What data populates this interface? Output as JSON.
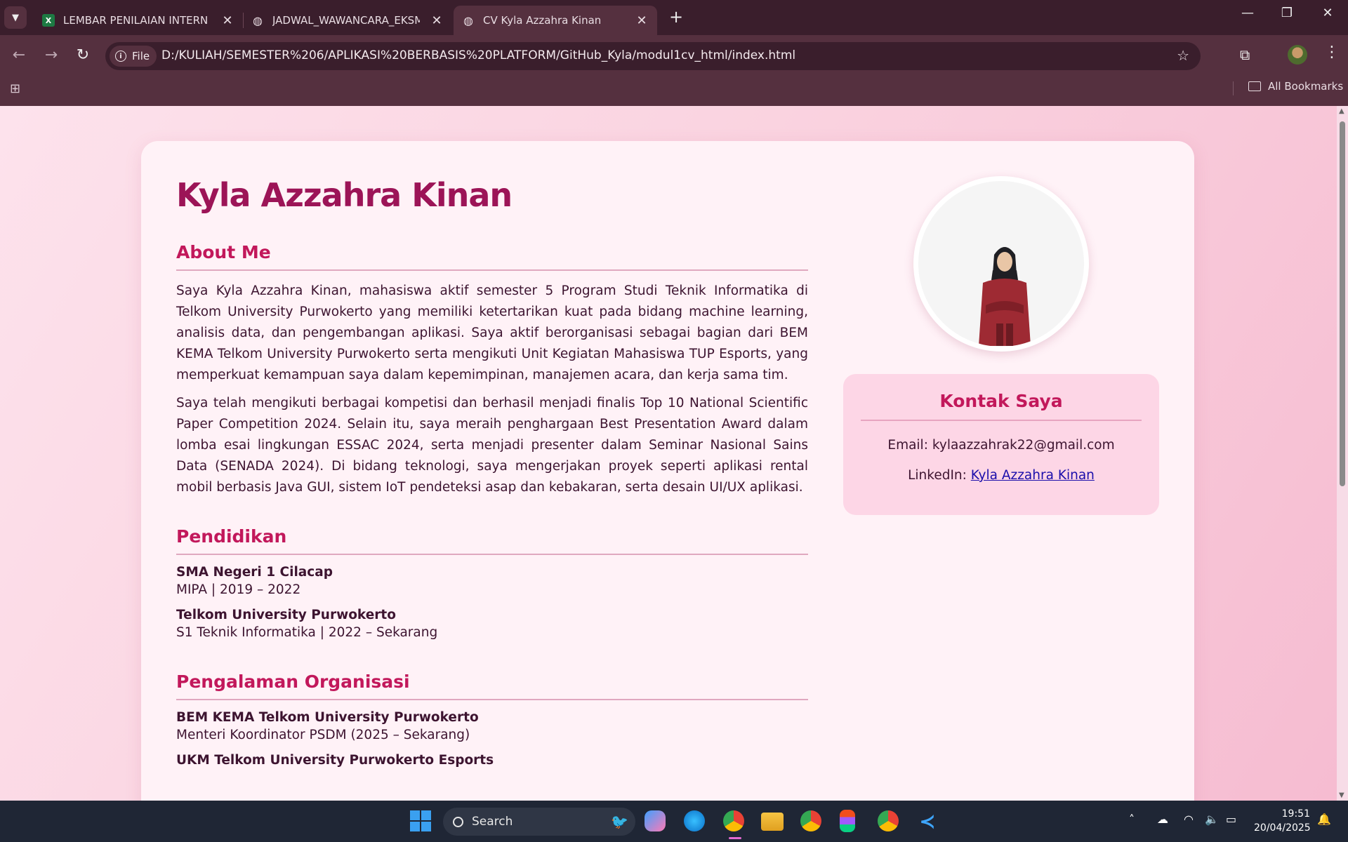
{
  "browser": {
    "tabs": [
      {
        "title": "LEMBAR PENILAIAN INTERN BE",
        "icon": "excel-icon"
      },
      {
        "title": "JADWAL_WAWANCARA_EKSMU",
        "icon": "globe-icon"
      },
      {
        "title": "CV Kyla Azzahra Kinan",
        "icon": "globe-icon",
        "active": true
      }
    ],
    "file_chip": "File",
    "url": "D:/KULIAH/SEMESTER%206/APLIKASI%20BERBASIS%20PLATFORM/GitHub_Kyla/modul1cv_html/index.html",
    "all_bookmarks": "All Bookmarks"
  },
  "cv": {
    "name": "Kyla Azzahra Kinan",
    "about_title": "About Me",
    "about_p1": "Saya Kyla Azzahra Kinan, mahasiswa aktif semester 5 Program Studi Teknik Informatika di Telkom University Purwokerto yang memiliki ketertarikan kuat pada bidang machine learning, analisis data, dan pengembangan aplikasi. Saya aktif berorganisasi sebagai bagian dari BEM KEMA Telkom University Purwokerto serta mengikuti Unit Kegiatan Mahasiswa TUP Esports, yang memperkuat kemampuan saya dalam kepemimpinan, manajemen acara, dan kerja sama tim.",
    "about_p2": "Saya telah mengikuti berbagai kompetisi dan berhasil menjadi finalis Top 10 National Scientific Paper Competition 2024. Selain itu, saya meraih penghargaan Best Presentation Award dalam lomba esai lingkungan ESSAC 2024, serta menjadi presenter dalam Seminar Nasional Sains Data (SENADA 2024). Di bidang teknologi, saya mengerjakan proyek seperti aplikasi rental mobil berbasis Java GUI, sistem IoT pendeteksi asap dan kebakaran, serta desain UI/UX aplikasi.",
    "education_title": "Pendidikan",
    "education": [
      {
        "school": "SMA Negeri 1 Cilacap",
        "detail": "MIPA | 2019 – 2022"
      },
      {
        "school": "Telkom University Purwokerto",
        "detail": "S1 Teknik Informatika | 2022 – Sekarang"
      }
    ],
    "org_title": "Pengalaman Organisasi",
    "organizations": [
      {
        "name": "BEM KEMA Telkom University Purwokerto",
        "detail": "Menteri Koordinator PSDM (2025 – Sekarang)"
      },
      {
        "name": "UKM Telkom University Purwokerto Esports",
        "detail": ""
      }
    ],
    "contact_title": "Kontak Saya",
    "email_label": "Email:",
    "email": "kylaazzahrak22@gmail.com",
    "linkedin_label": "LinkedIn:",
    "linkedin": "Kyla Azzahra Kinan"
  },
  "taskbar": {
    "search_label": "Search",
    "time": "19:51",
    "date": "20/04/2025"
  },
  "colors": {
    "accent": "#c2185b",
    "name": "#9c1457",
    "page_bg": "#fad3e0"
  }
}
